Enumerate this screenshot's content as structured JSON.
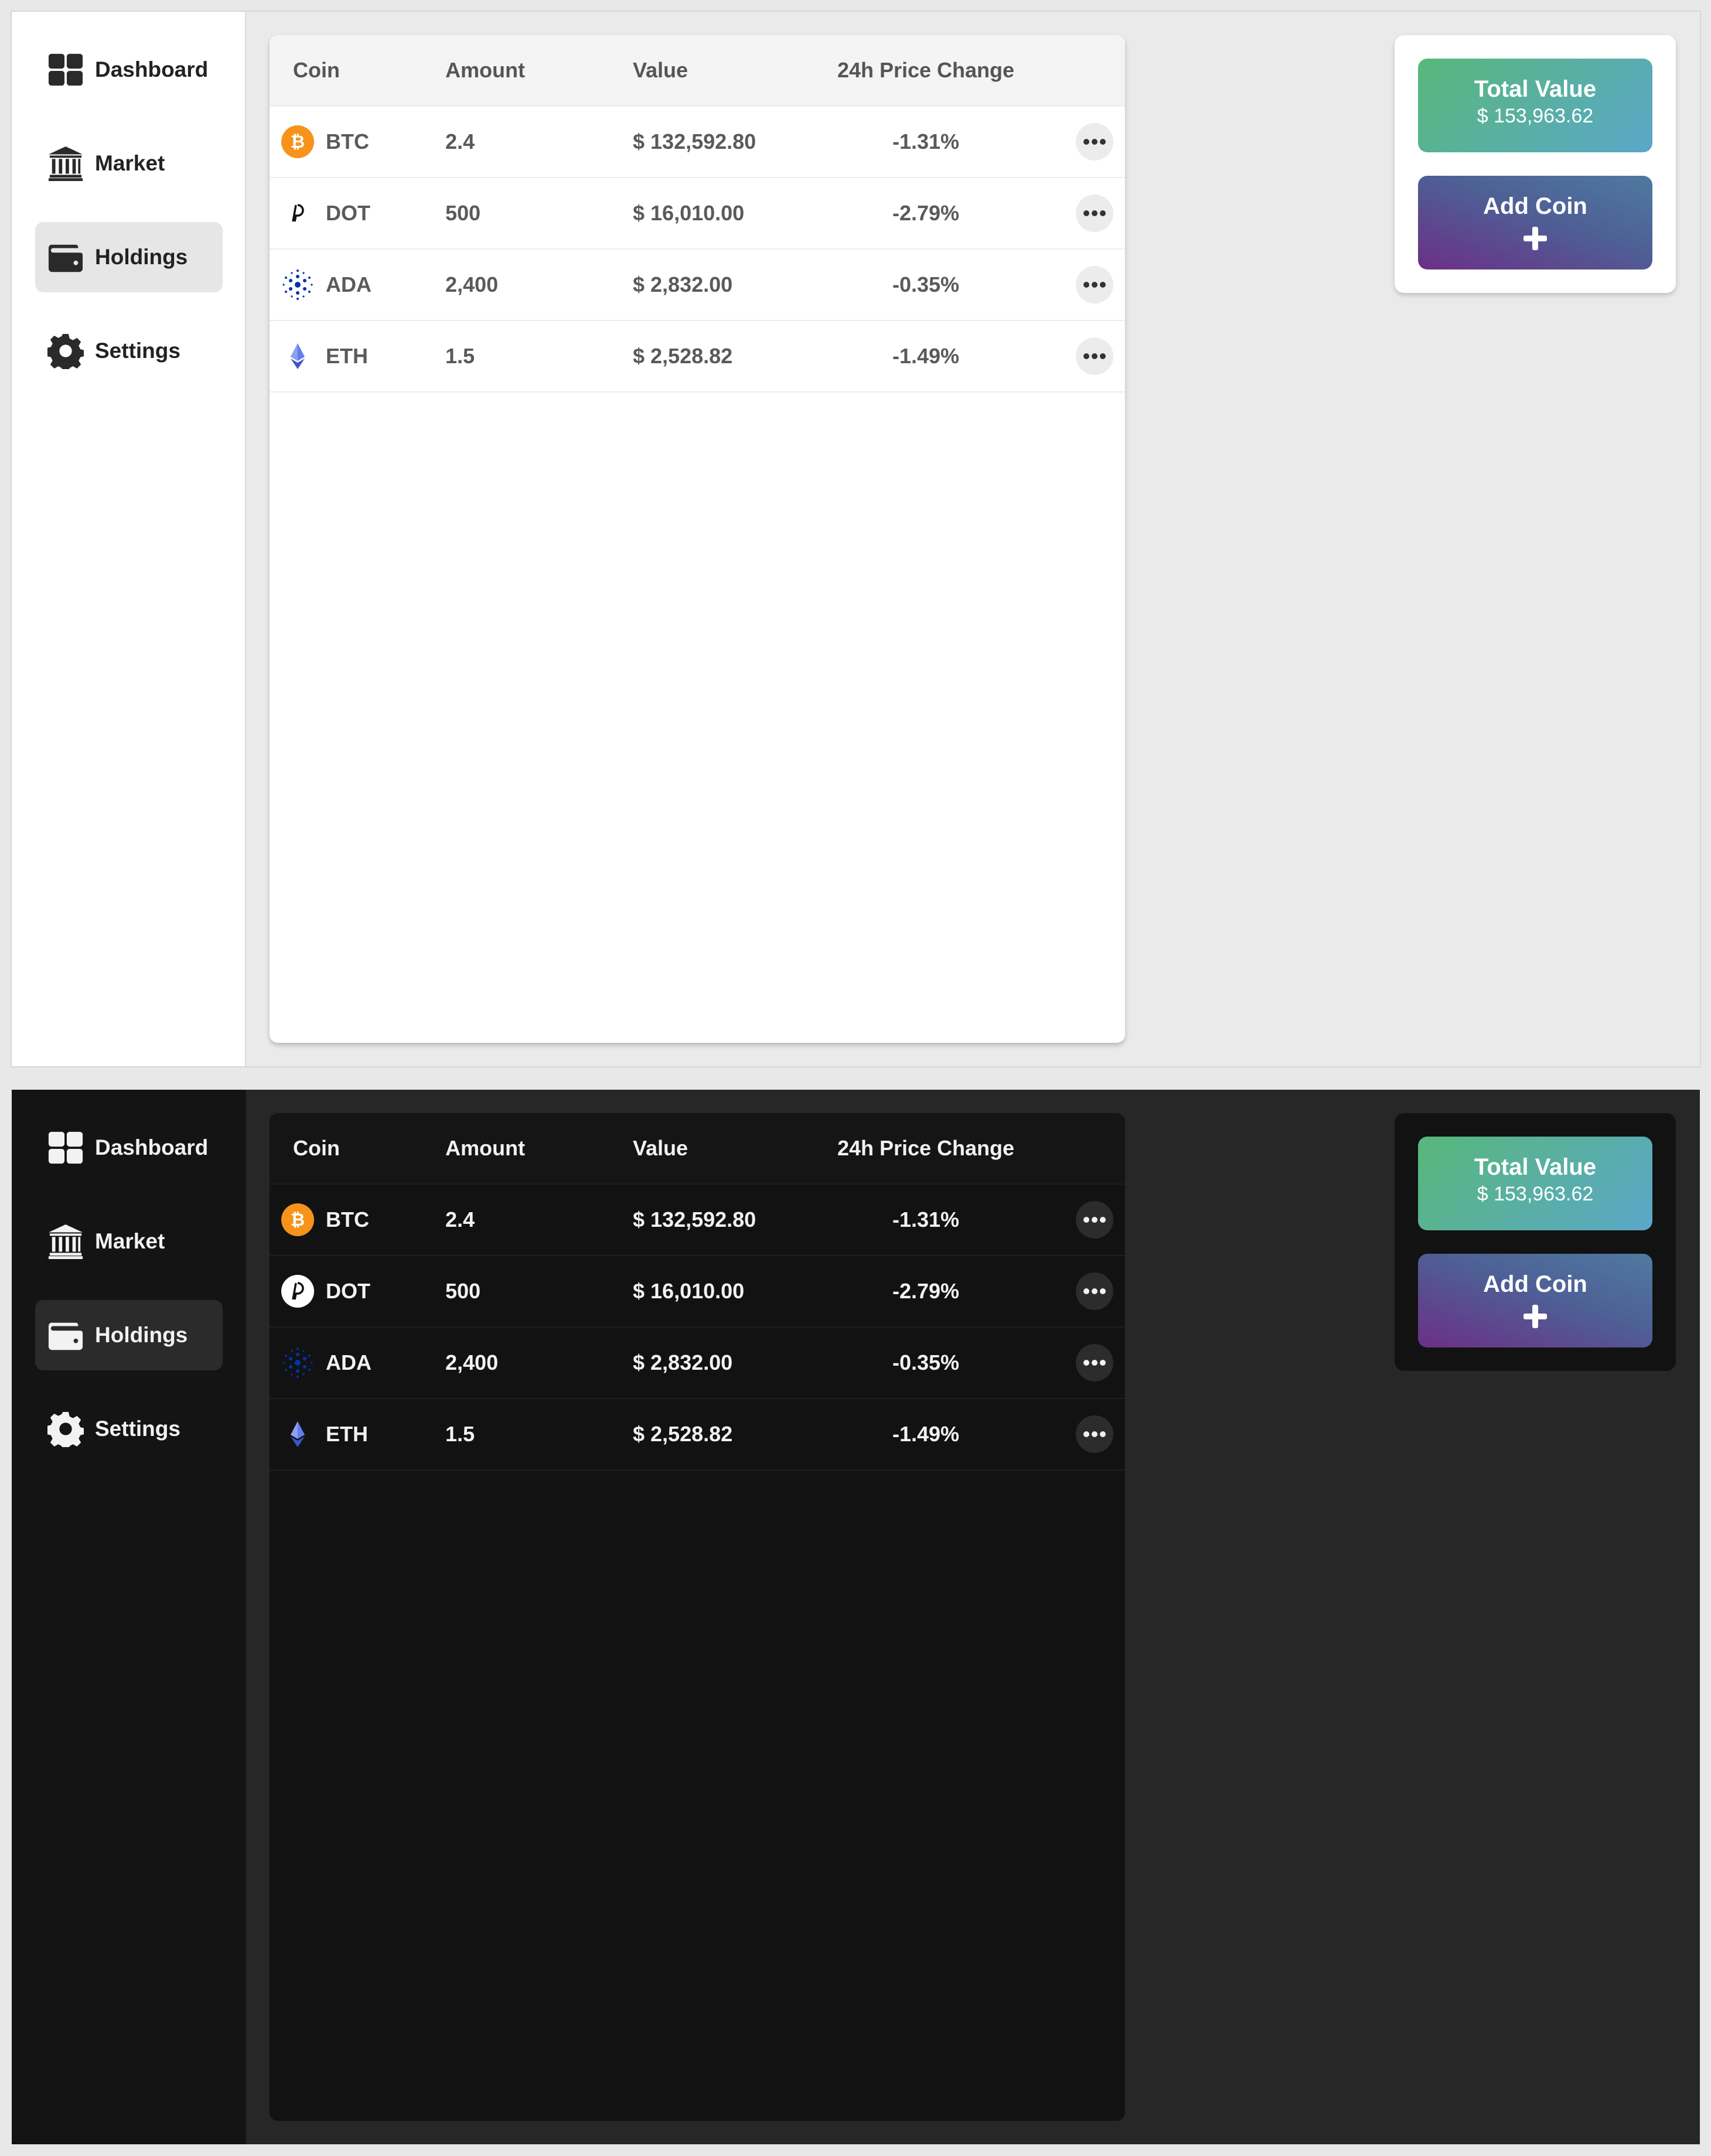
{
  "nav": [
    {
      "label": "Dashboard",
      "icon": "dashboard-icon"
    },
    {
      "label": "Market",
      "icon": "bank-icon"
    },
    {
      "label": "Holdings",
      "icon": "wallet-icon"
    },
    {
      "label": "Settings",
      "icon": "gear-icon"
    }
  ],
  "active_nav": "Holdings",
  "table": {
    "headers": {
      "coin": "Coin",
      "amount": "Amount",
      "value": "Value",
      "change": "24h Price Change"
    },
    "rows": [
      {
        "coin": "BTC",
        "amount": "2.4",
        "value": "$ 132,592.80",
        "change": "-1.31%",
        "icon": "bitcoin-icon"
      },
      {
        "coin": "DOT",
        "amount": "500",
        "value": "$ 16,010.00",
        "change": "-2.79%",
        "icon": "polkadot-icon"
      },
      {
        "coin": "ADA",
        "amount": "2,400",
        "value": "$ 2,832.00",
        "change": "-0.35%",
        "icon": "cardano-icon"
      },
      {
        "coin": "ETH",
        "amount": "1.5",
        "value": "$ 2,528.82",
        "change": "-1.49%",
        "icon": "ethereum-icon"
      }
    ]
  },
  "summary": {
    "total_title": "Total Value",
    "total_value": "$ 153,963.62",
    "add_label": "Add Coin"
  },
  "themes": [
    "light",
    "dark"
  ],
  "colors": {
    "btc": "#f7931a",
    "ada": "#0033ad",
    "eth": "#627eea",
    "total_gradient": [
      "#58b87a",
      "#5aa7c9"
    ],
    "add_gradient": [
      "#6c2f86",
      "#4f7aa0"
    ]
  }
}
